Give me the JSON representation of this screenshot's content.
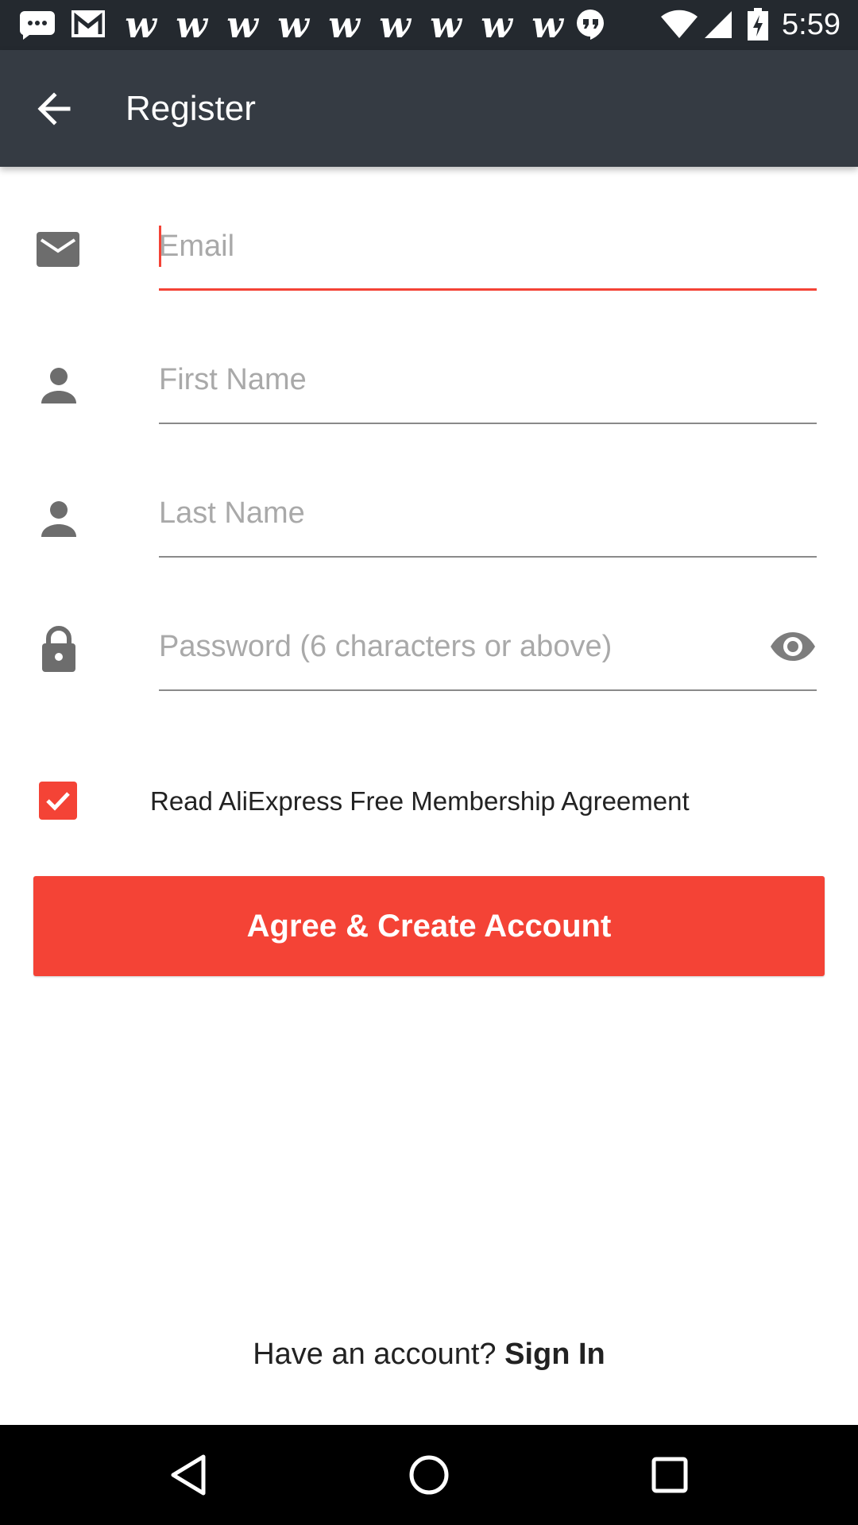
{
  "status_bar": {
    "time": "5:59",
    "notification_icons": [
      "chat-notification-icon",
      "gmail-icon",
      "w-app-icon",
      "w-app-icon",
      "w-app-icon",
      "w-app-icon",
      "w-app-icon",
      "w-app-icon",
      "w-app-icon",
      "w-app-icon",
      "w-app-icon",
      "hangouts-icon"
    ],
    "w_glyph": "w",
    "system_icons": [
      "wifi-icon",
      "cell-signal-icon",
      "battery-charging-icon"
    ]
  },
  "app_bar": {
    "title": "Register"
  },
  "form": {
    "email_placeholder": "Email",
    "first_name_placeholder": "First Name",
    "last_name_placeholder": "Last Name",
    "password_placeholder": "Password (6 characters or above)"
  },
  "agreement": {
    "checked": true,
    "label": "Read AliExpress Free Membership Agreement"
  },
  "primary_button": {
    "label": "Agree & Create Account"
  },
  "signin": {
    "prompt": "Have an account? ",
    "link": "Sign In"
  },
  "colors": {
    "accent": "#f44336",
    "app_bar": "#353b43",
    "status_bar": "#24292f",
    "icon_gray": "#6d6d6d"
  }
}
